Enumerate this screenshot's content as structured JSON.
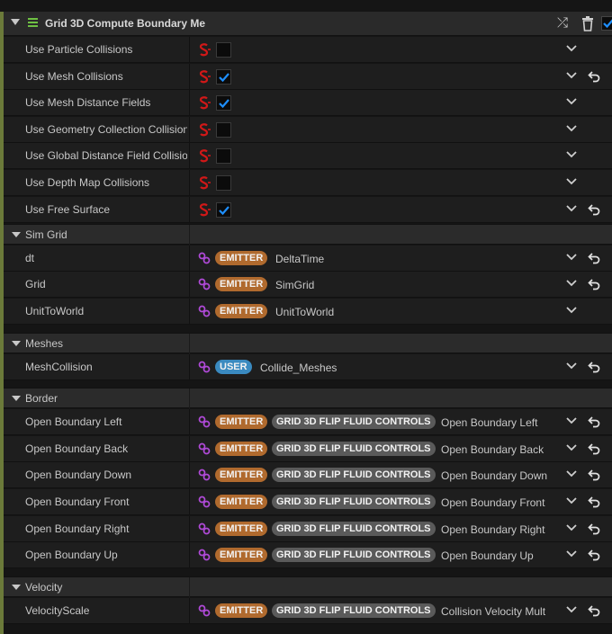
{
  "module": {
    "title": "Grid 3D Compute Boundary Me"
  },
  "collision_rows": [
    {
      "label": "Use Particle Collisions",
      "checked": false,
      "reset": false
    },
    {
      "label": "Use Mesh Collisions",
      "checked": true,
      "reset": true
    },
    {
      "label": "Use Mesh Distance Fields",
      "checked": true,
      "reset": false
    },
    {
      "label": "Use Geometry Collection Collisions",
      "checked": false,
      "reset": false
    },
    {
      "label": "Use Global Distance Field Collisions",
      "checked": false,
      "reset": false
    },
    {
      "label": "Use Depth Map Collisions",
      "checked": false,
      "reset": false
    },
    {
      "label": "Use Free Surface",
      "checked": true,
      "reset": true
    }
  ],
  "categories": {
    "sim_grid": "Sim Grid",
    "meshes": "Meshes",
    "border": "Border",
    "velocity": "Velocity"
  },
  "sim_grid_rows": [
    {
      "label": "dt",
      "tag": "EMITTER",
      "value": "DeltaTime",
      "reset": true
    },
    {
      "label": "Grid",
      "tag": "EMITTER",
      "value": "SimGrid",
      "reset": true
    },
    {
      "label": "UnitToWorld",
      "tag": "EMITTER",
      "value": "UnitToWorld",
      "reset": false
    }
  ],
  "mesh_rows": [
    {
      "label": "MeshCollision",
      "tag": "USER",
      "value": "Collide_Meshes",
      "reset": true
    }
  ],
  "border_rows": [
    {
      "label": "Open Boundary  Left",
      "tag": "EMITTER",
      "group": "GRID 3D FLIP FLUID CONTROLS",
      "value": "Open Boundary Left"
    },
    {
      "label": "Open Boundary Back",
      "tag": "EMITTER",
      "group": "GRID 3D FLIP FLUID CONTROLS",
      "value": "Open Boundary Back"
    },
    {
      "label": "Open Boundary Down",
      "tag": "EMITTER",
      "group": "GRID 3D FLIP FLUID CONTROLS",
      "value": "Open Boundary Down"
    },
    {
      "label": "Open Boundary Front",
      "tag": "EMITTER",
      "group": "GRID 3D FLIP FLUID CONTROLS",
      "value": "Open Boundary Front"
    },
    {
      "label": "Open Boundary Right",
      "tag": "EMITTER",
      "group": "GRID 3D FLIP FLUID CONTROLS",
      "value": "Open Boundary Right"
    },
    {
      "label": "Open Boundary Up",
      "tag": "EMITTER",
      "group": "GRID 3D FLIP FLUID CONTROLS",
      "value": "Open Boundary Up"
    }
  ],
  "velocity_rows": [
    {
      "label": "VelocityScale",
      "tag": "EMITTER",
      "group": "GRID 3D FLIP FLUID CONTROLS",
      "value": "Collision Velocity Mult"
    }
  ],
  "colors": {
    "emitter_tag": "#b06a2e",
    "user_tag": "#3a8ac0",
    "group_tag": "#5a5a5a",
    "checkbox_check": "#1e8fff",
    "link_icon": "#b04ad8",
    "static_switch_icon": "#d01818",
    "module_accent": "#6ec043"
  },
  "icons": {
    "static_switch": "static-switch-icon",
    "linked_input": "link-icon",
    "dropdown": "chevron-down-icon",
    "reset": "reset-arrow-icon",
    "shuffle": "shuffle-icon",
    "delete": "trash-icon"
  }
}
